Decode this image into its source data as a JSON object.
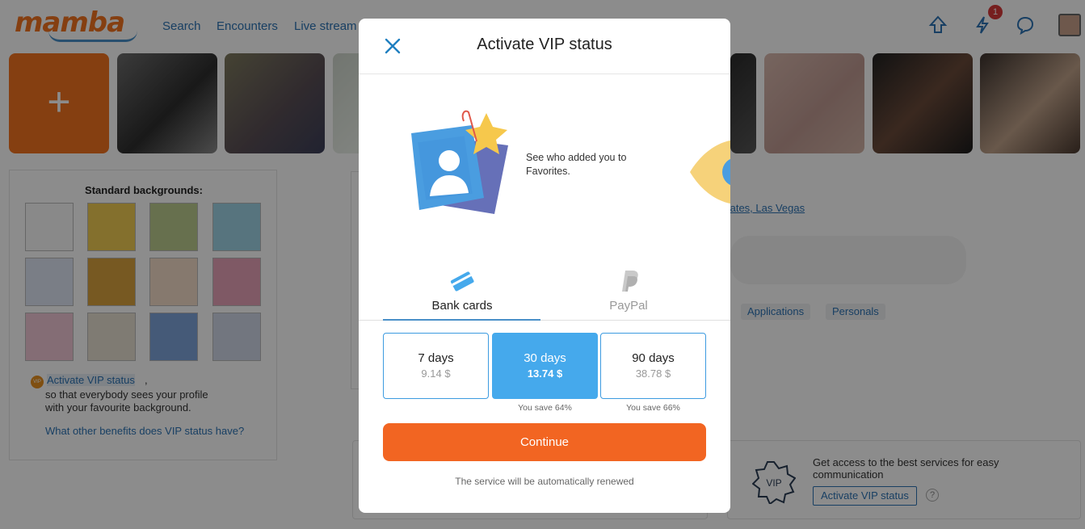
{
  "header": {
    "logo": "mamba",
    "nav": [
      "Search",
      "Encounters",
      "Live stream"
    ],
    "notification_count": "1"
  },
  "photo_strip": {
    "add_label": "+"
  },
  "backgrounds_panel": {
    "title": "Standard backgrounds:",
    "vip_link": "Activate VIP status",
    "vip_link_suffix": ",",
    "line1": "so that everybody sees your profile",
    "line2": "with your favourite background.",
    "benefits_link": "What other benefits does VIP status have?"
  },
  "profile": {
    "location_link": "tates, Las Vegas",
    "chips": [
      "Applications",
      "Personals"
    ]
  },
  "vip_card": {
    "text": "Get access to the best services for easy communication",
    "button": "Activate VIP status",
    "help": "?",
    "badge": "VIP"
  },
  "modal": {
    "title": "Activate VIP status",
    "promo_text": "See who added you to Favorites.",
    "tabs": [
      {
        "label": "Bank cards",
        "icon": "credit-card-icon",
        "active": true
      },
      {
        "label": "PayPal",
        "icon": "paypal-icon",
        "active": false
      }
    ],
    "plans": [
      {
        "days": "7 days",
        "price": "9.14 $",
        "selected": false,
        "save": ""
      },
      {
        "days": "30 days",
        "price": "13.74 $",
        "selected": true,
        "save": "You save 64%"
      },
      {
        "days": "90 days",
        "price": "38.78 $",
        "selected": false,
        "save": "You save 66%"
      }
    ],
    "continue_label": "Continue",
    "renew_note": "The service will be automatically renewed"
  },
  "colors": {
    "brand_orange": "#f26522",
    "accent_blue": "#45a9ec",
    "link_blue": "#2d74b5"
  }
}
